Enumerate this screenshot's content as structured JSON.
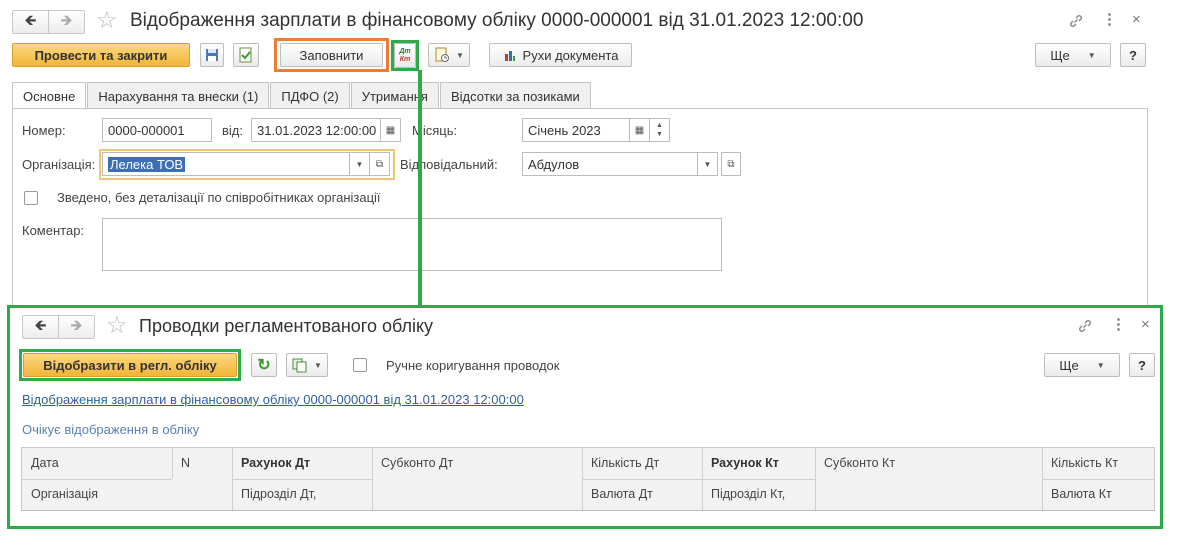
{
  "doc": {
    "title": "Відображення зарплати в фінансовому обліку 0000-000001 від 31.01.2023 12:00:00",
    "toolbar": {
      "post_close": "Провести та закрити",
      "fill": "Заповнити",
      "dtkt_top": "Дт",
      "dtkt_bottom": "Кт",
      "movements": "Рухи документа",
      "more": "Ще",
      "help": "?"
    },
    "tabs": [
      "Основне",
      "Нарахування та внески (1)",
      "ПДФО (2)",
      "Утримання",
      "Відсотки за позиками"
    ],
    "form": {
      "number_label": "Номер:",
      "number_value": "0000-000001",
      "date_label": "від:",
      "date_value": "31.01.2023 12:00:00",
      "month_label": "Місяць:",
      "month_value": "Січень 2023",
      "org_label": "Організація:",
      "org_value": "Лелека ТОВ",
      "resp_label": "Відповідальний:",
      "resp_value": "Абдулов",
      "summary_label": "Зведено, без деталізації по співробітниках організації",
      "comment_label": "Коментар:",
      "comment_value": ""
    }
  },
  "entries": {
    "title": "Проводки регламентованого обліку",
    "reflect_button": "Відобразити в регл. обліку",
    "manual_label": "Ручне коригування проводок",
    "more": "Ще",
    "help": "?",
    "doc_link": "Відображення зарплати в фінансовому обліку 0000-000001 від 31.01.2023 12:00:00",
    "status": "Очікує відображення в обліку",
    "columns": {
      "date": "Дата",
      "n": "N",
      "account_dt": "Рахунок Дт",
      "subconto_dt": "Субконто Дт",
      "qty_dt": "Кількість Дт",
      "account_kt": "Рахунок Кт",
      "subconto_kt": "Субконто Кт",
      "qty_kt": "Кількість Кт",
      "org": "Організація",
      "dept_dt": "Підрозділ Дт,",
      "currency_dt": "Валюта Дт",
      "dept_kt": "Підрозділ Кт,",
      "currency_kt": "Валюта Кт"
    }
  },
  "colors": {
    "highlight_orange": "#ee7d31",
    "highlight_green": "#2faa4a",
    "primary_button": "#f2b536",
    "link": "#2f5f9f"
  },
  "icons": [
    "back-arrow-icon",
    "forward-arrow-icon",
    "star-icon",
    "link-icon",
    "more-vert-icon",
    "close-icon",
    "save-icon",
    "post-icon",
    "dt-kt-icon",
    "report-icon",
    "calendar-icon",
    "refresh-icon",
    "copy-icon"
  ]
}
